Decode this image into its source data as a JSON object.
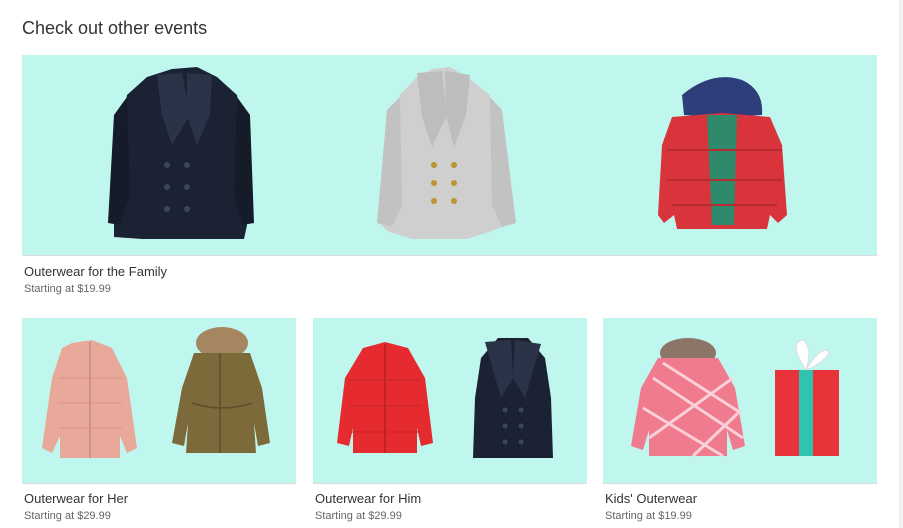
{
  "section_title": "Check out other events",
  "events": [
    {
      "title": "Outerwear for the Family",
      "price": "Starting at $19.99",
      "banner_color": "#bff7ef"
    },
    {
      "title": "Outerwear for Her",
      "price": "Starting at $29.99",
      "banner_color": "#bff7ef"
    },
    {
      "title": "Outerwear for Him",
      "price": "Starting at $29.99",
      "banner_color": "#bff7ef"
    },
    {
      "title": "Kids' Outerwear",
      "price": "Starting at $19.99",
      "banner_color": "#bff7ef"
    }
  ],
  "colors": {
    "navy_coat": "#1b2233",
    "grey_coat": "#cfcfcf",
    "red_jacket": "#d9343b",
    "pink_jacket": "#e8a89a",
    "olive_parka": "#7d6a3a",
    "pink_kids_jacket": "#f07a8e",
    "gift_red": "#e8333a",
    "gift_ribbon": "#2ec4b0"
  }
}
